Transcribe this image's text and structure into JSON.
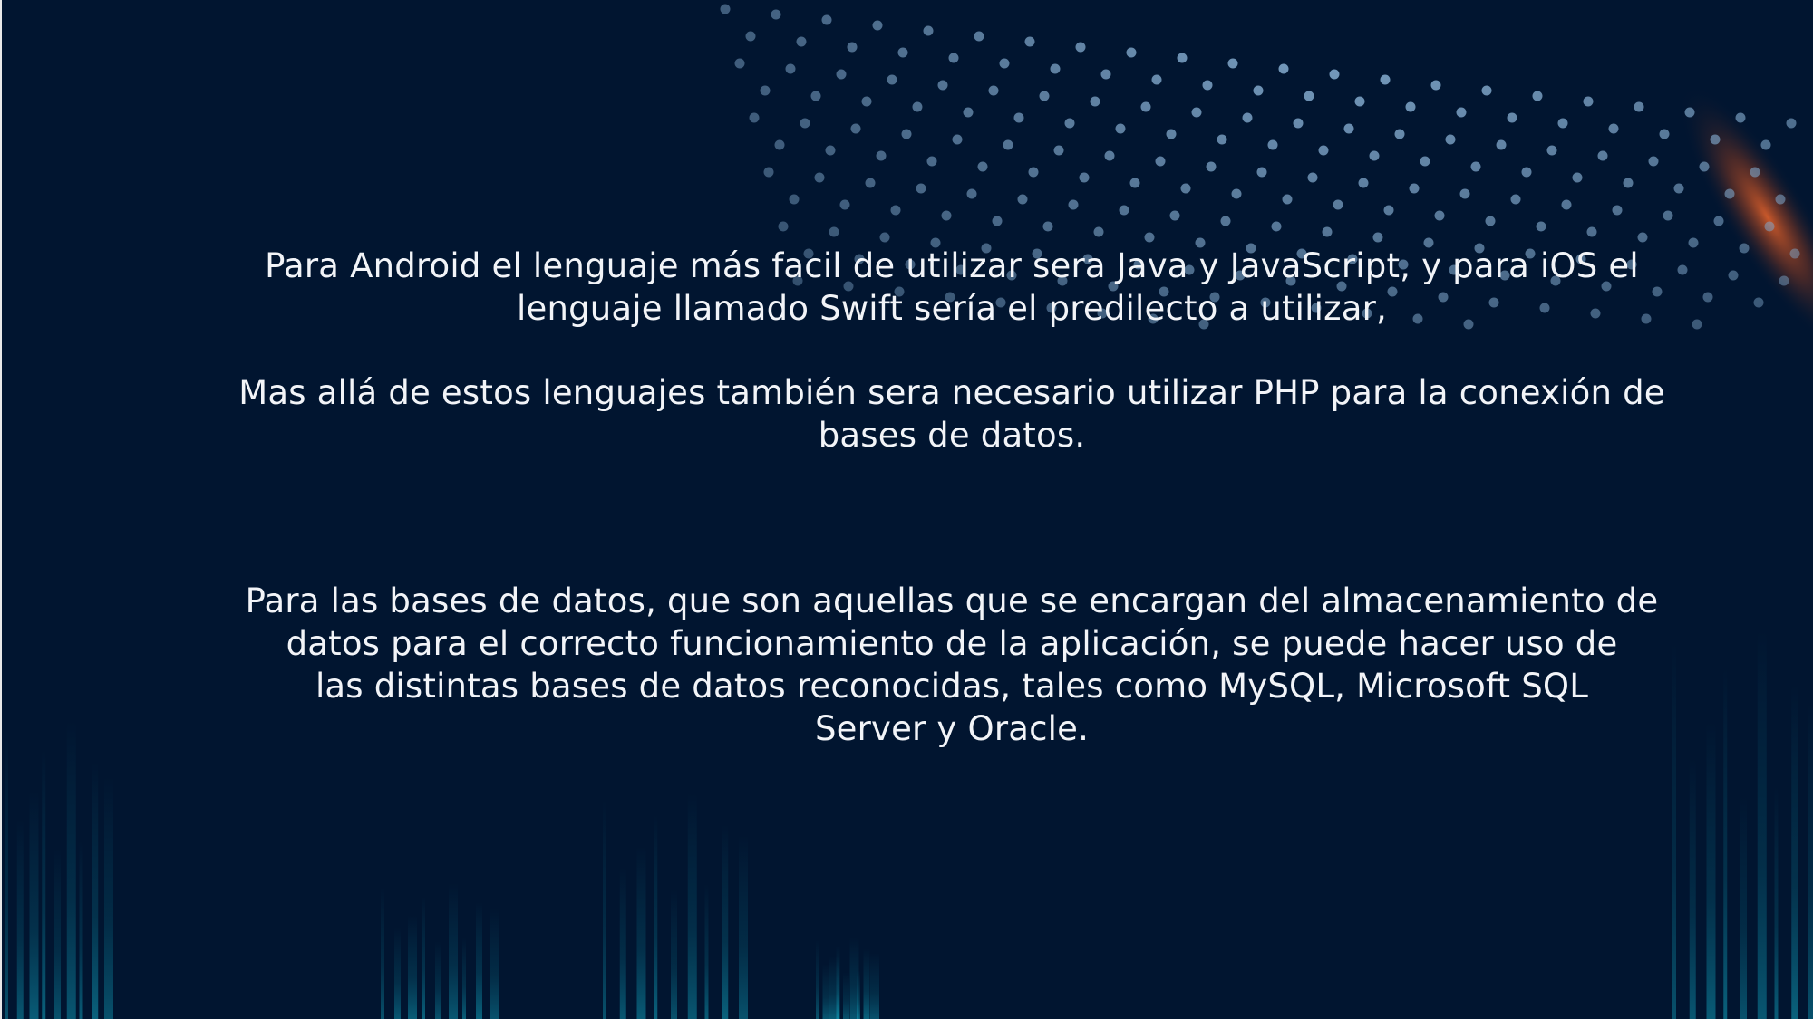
{
  "slide": {
    "paragraphs": [
      "Para Android el lenguaje más facil de utilizar sera Java y JavaScript, y para iOS el\nlenguaje llamado Swift sería el predilecto a utilizar,",
      "Mas allá de estos lenguajes también sera necesario utilizar PHP para la conexión de\nbases de datos.",
      "Para las bases de datos, que son aquellas que se encargan del almacenamiento de\n     datos para el correcto funcionamiento de la aplicación, se puede hacer uso de\n     las distintas bases de datos reconocidas, tales como MySQL, Microsoft SQL\nServer y Oracle."
    ]
  },
  "colors": {
    "background": "#011530",
    "text": "#f2f4f8",
    "dot_pattern": "#7fa6c9",
    "glow_teal": "#0a8aa3",
    "glow_orange": "#e0602a"
  },
  "decorations": {
    "dot_pattern_icon": "dot-grid-pattern",
    "light_streaks_icon": "teal-light-streaks",
    "orange_flare_icon": "orange-flare"
  }
}
